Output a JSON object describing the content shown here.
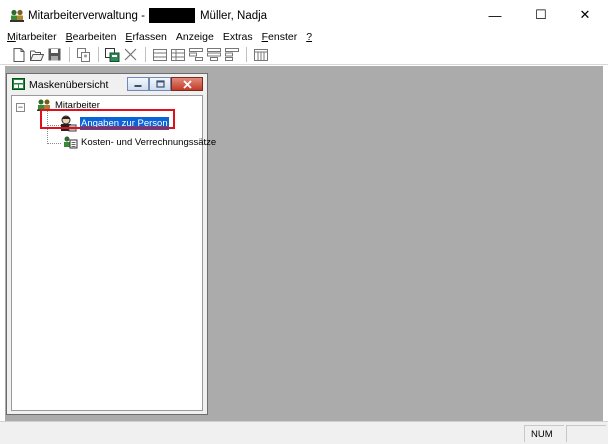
{
  "window": {
    "title_prefix": "Mitarbeiterverwaltung -",
    "title_suffix": "Müller, Nadja",
    "minimize_glyph": "—",
    "maximize_glyph": "☐",
    "close_glyph": "✕"
  },
  "menu": [
    {
      "underline": "M",
      "rest": "itarbeiter"
    },
    {
      "underline": "B",
      "rest": "earbeiten"
    },
    {
      "underline": "E",
      "rest": "rfassen"
    },
    {
      "underline": "",
      "rest": "Anzeige"
    },
    {
      "underline": "",
      "rest": "Extras"
    },
    {
      "underline": "F",
      "rest": "enster"
    },
    {
      "underline": "?",
      "rest": ""
    }
  ],
  "toolbar": {
    "icons": [
      "new-document-icon",
      "open-folder-icon",
      "save-disk-icon",
      "copy-record-icon",
      "new-window-icon",
      "delete-icon",
      "grid-view-icon",
      "table-view-icon",
      "form-view-icon",
      "list-view-icon",
      "split-view-icon",
      "columns-view-icon"
    ]
  },
  "child_window": {
    "title": "Maskenübersicht"
  },
  "tree": {
    "root": {
      "label": "Mitarbeiter",
      "expander": "−"
    },
    "children": [
      {
        "label": "Angaben zur Person",
        "selected": true
      },
      {
        "label": "Kosten- und Verrechnungssätze",
        "selected": false
      }
    ]
  },
  "statusbar": {
    "num": "NUM",
    "empty": ""
  },
  "colors": {
    "selection": "#0a64d8",
    "highlight_box": "#e0101a",
    "mdi_background": "#ababab"
  }
}
